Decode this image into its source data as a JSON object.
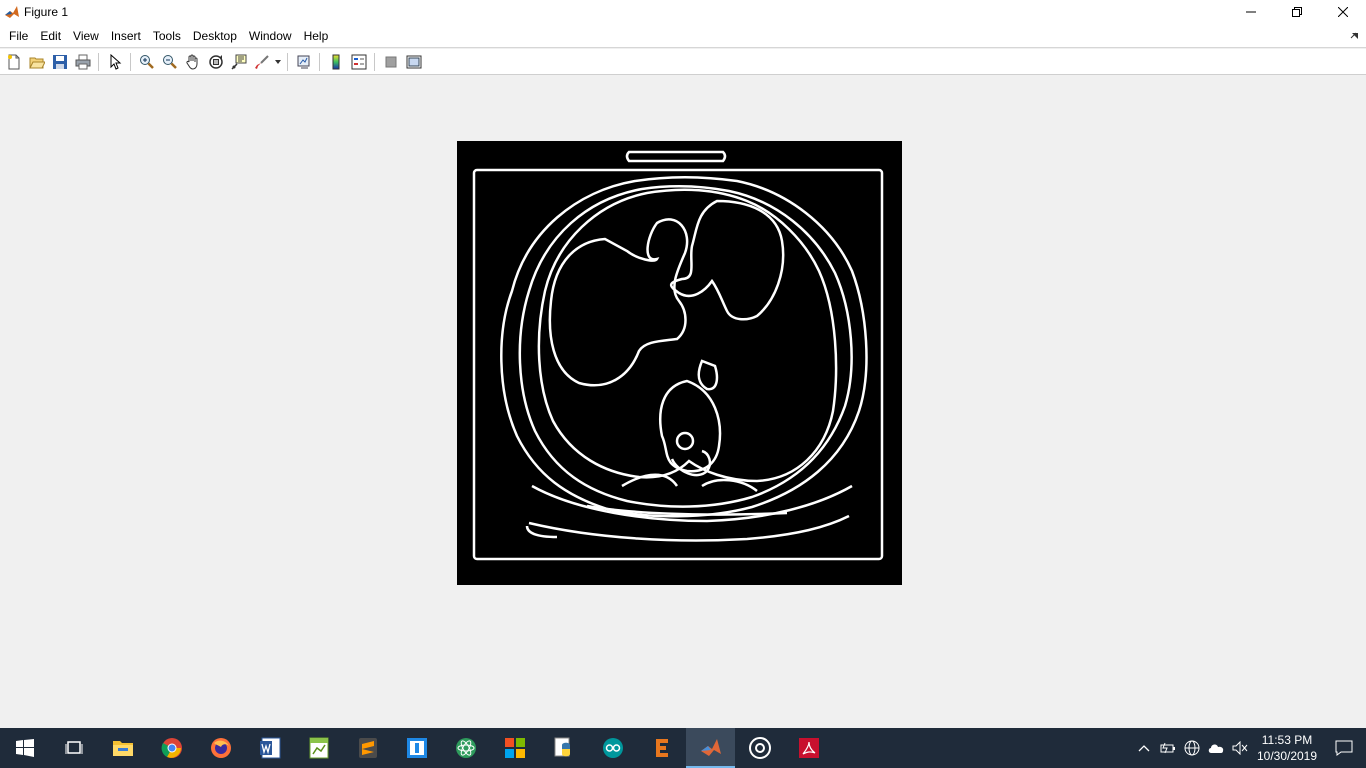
{
  "window": {
    "title": "Figure 1"
  },
  "menu": {
    "items": [
      "File",
      "Edit",
      "View",
      "Insert",
      "Tools",
      "Desktop",
      "Window",
      "Help"
    ]
  },
  "toolbar": {
    "icons": [
      "new-figure-icon",
      "open-file-icon",
      "save-icon",
      "print-icon",
      "select-pointer-icon",
      "zoom-in-icon",
      "zoom-out-icon",
      "pan-hand-icon",
      "rotate-3d-icon",
      "data-cursor-icon",
      "brush-icon",
      "link-plot-icon",
      "insert-colorbar-icon",
      "insert-legend-icon",
      "hide-plot-tools-icon",
      "show-plot-tools-icon"
    ]
  },
  "figure": {
    "image": "binary edge-detection image of CT scan",
    "background": "#000000",
    "edge_color": "#ffffff"
  },
  "taskbar": {
    "apps": [
      "start-icon",
      "task-view-icon",
      "file-explorer-icon",
      "chrome-icon",
      "firefox-icon",
      "word-icon",
      "editor-icon",
      "sublime-text-icon",
      "terminal-app-icon",
      "atom-icon",
      "windows-tiles-icon",
      "python-icon",
      "arduino-icon",
      "e-app-icon",
      "matlab-icon",
      "obs-icon",
      "acrobat-icon"
    ],
    "clock_time": "11:53 PM",
    "clock_date": "10/30/2019"
  },
  "colors": {
    "taskbar": "#1f2b3a",
    "figure_bg": "#f0f0f0",
    "accent": "#76b9ed"
  }
}
